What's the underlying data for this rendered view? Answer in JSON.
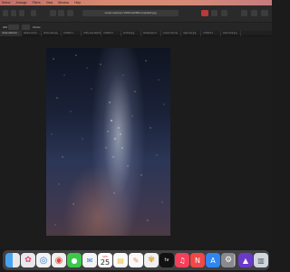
{
  "menubar": {
    "items": [
      "Select",
      "Arrange",
      "Filters",
      "View",
      "Window",
      "Help"
    ]
  },
  "toolbar": {
    "document_title": "ronan-swinnen-VS6CoinFMN-unsplash.jpg"
  },
  "context_bar": {
    "dpi": "300",
    "label": "Fitsize"
  },
  "tabs": [
    "ronan-swinnen...",
    "adobe-stock-...",
    "photo-edit.jpg",
    "Untitled 1",
    "milky-way.afphoto",
    "Untitled 2",
    "portrait.jpg",
    "landscape.tif",
    "export-01.png",
    "night-sky.jpg",
    "Untitled 3",
    "stars-final.jpg"
  ],
  "dock": {
    "calendar_month": "SEP",
    "calendar_day": "25",
    "icons": [
      "finder-icon",
      "launchpad-icon",
      "safari-icon",
      "chrome-icon",
      "messages-icon",
      "facetime-icon",
      "mail-icon",
      "maps-icon",
      "photos-icon",
      "calendar-icon",
      "contacts-icon",
      "reminders-icon",
      "notes-icon",
      "freeform-icon",
      "appletv-icon",
      "music-icon",
      "podcasts-icon",
      "news-icon",
      "keynote-icon",
      "numbers-icon",
      "pages-icon",
      "appstore-icon",
      "settings-icon",
      "affinity-photo-icon",
      "downloads-stack-icon",
      "trash-icon"
    ],
    "tv_label": "tv"
  }
}
